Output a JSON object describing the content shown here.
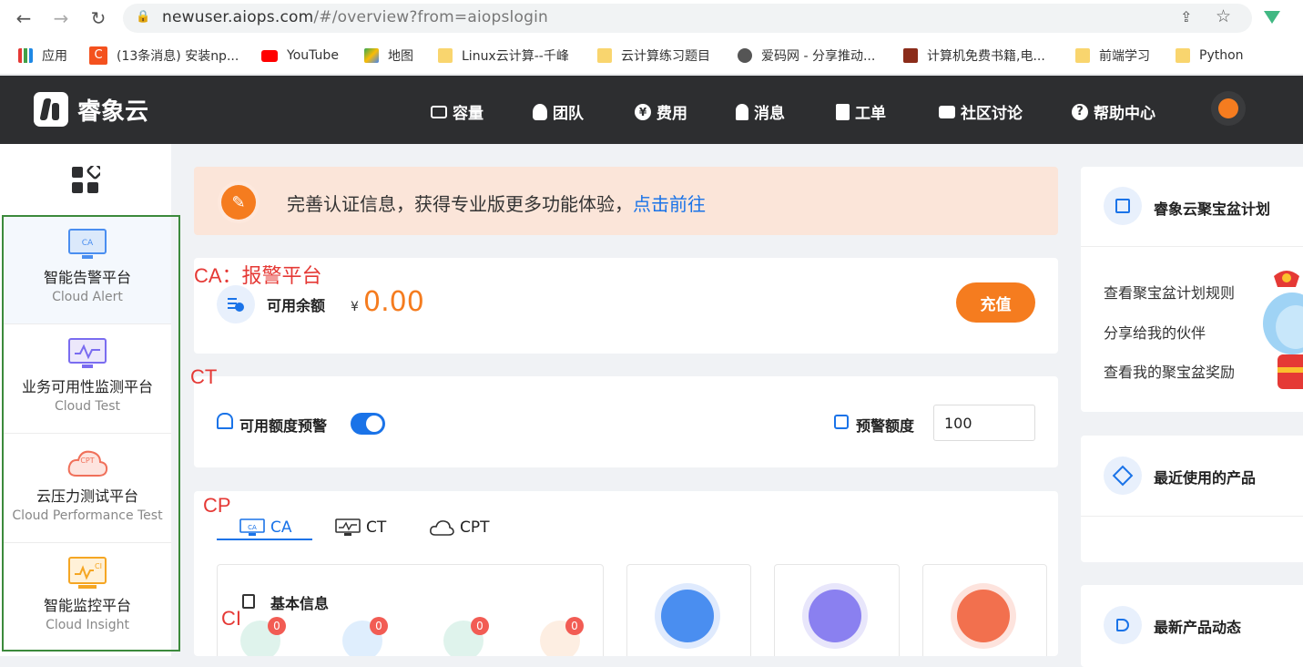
{
  "browser": {
    "url_host": "newuser.aiops.com",
    "url_path": "/#/overview?from=aiopslogin",
    "bookmarks": [
      "应用",
      "(13条消息) 安装np...",
      "YouTube",
      "地图",
      "Linux云计算--千峰",
      "云计算练习题目",
      "爱码网 - 分享推动...",
      "计算机免费书籍,电...",
      "前端学习",
      "Python"
    ]
  },
  "header": {
    "logo_text": "睿象云",
    "nav": [
      "容量",
      "团队",
      "费用",
      "消息",
      "工单",
      "社区讨论",
      "帮助中心"
    ]
  },
  "sidebar": {
    "items": [
      {
        "title": "智能告警平台",
        "subtitle": "Cloud Alert"
      },
      {
        "title": "业务可用性监测平台",
        "subtitle": "Cloud Test"
      },
      {
        "title": "云压力测试平台",
        "subtitle": "Cloud Performance Test"
      },
      {
        "title": "智能监控平台",
        "subtitle": "Cloud Insight"
      }
    ]
  },
  "banner": {
    "text": "完善认证信息，获得专业版更多功能体验，",
    "link": "点击前往"
  },
  "annotations": {
    "ca": "CA：报警平台",
    "ct": "CT",
    "cp": "CP",
    "ci": "CI"
  },
  "balance": {
    "label": "可用余额",
    "currency": "¥",
    "amount": "0.00",
    "recharge": "充值"
  },
  "alert": {
    "label": "可用额度预警",
    "enabled": true,
    "threshold_label": "预警额度",
    "threshold_value": "100"
  },
  "tabs": [
    "CA",
    "CT",
    "CPT"
  ],
  "basic_info": {
    "title": "基本信息",
    "badges": [
      "0",
      "0",
      "0",
      "0"
    ]
  },
  "right": {
    "plan_title": "睿象云聚宝盆计划",
    "plan_links": [
      "查看聚宝盆计划规则",
      "分享给我的伙伴",
      "查看我的聚宝盆奖励"
    ],
    "recent_title": "最近使用的产品",
    "news_title": "最新产品动态"
  },
  "colors": {
    "accent": "#f57c1f",
    "primary": "#1a73e8",
    "annotation": "#e53935",
    "highlight_box": "#3c8a3c"
  }
}
